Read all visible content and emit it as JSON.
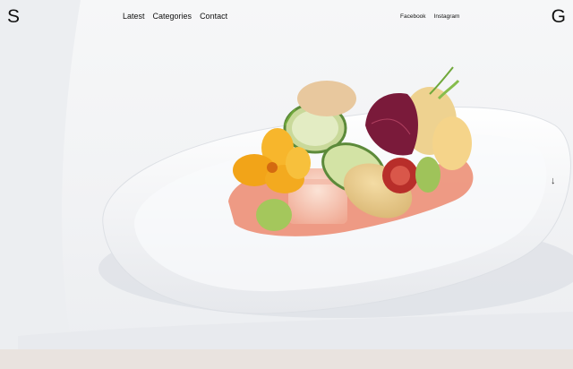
{
  "brand": {
    "logo_left": "S",
    "logo_right": "G"
  },
  "nav": {
    "items": [
      "Latest",
      "Categories",
      "Contact"
    ]
  },
  "social": {
    "items": [
      "Facebook",
      "Instagram"
    ]
  },
  "scroll": {
    "glyph": "↓"
  }
}
